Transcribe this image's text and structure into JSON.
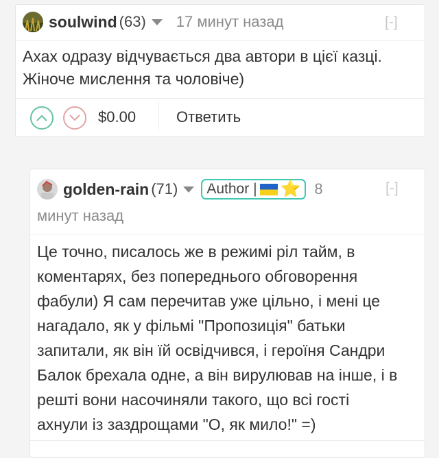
{
  "comments": [
    {
      "username": "soulwind",
      "reputation": "(63)",
      "time": "17 минут назад",
      "collapse_label": "[-]",
      "body": [
        "Ахах одразу відчувається два автори в цієї казці.",
        "Жіноче мислення та чоловіче)"
      ],
      "payout": "$0.00",
      "reply_label": "Ответить"
    },
    {
      "username": "golden-rain",
      "reputation": "(71)",
      "badge": {
        "text": "Author |",
        "flag": "ukraine-flag",
        "star": "⭐"
      },
      "time_part1": "8",
      "time_part2": "минут назад",
      "collapse_label": "[-]",
      "body": [
        "Це точно, писалось же в режимі ріл тайм, в",
        "коментарях, без попереднього обговорення",
        "фабули) Я сам перечитав уже цільно, і мені це",
        "нагадало, як у фільмі \"Пропозиція\" батьки",
        "запитали, як він їй освідчився, і героїня Сандри",
        "Балок брехала одне, а він вирулював на інше, і в",
        "решті вони насочиняли такого, що всі гості",
        "ахнули із заздрощами \"О, як мило!\" =)"
      ]
    }
  ],
  "colors": {
    "upvote": "#63c1a6",
    "downvote": "#e3a3a3",
    "badge_border": "#3fc8b3"
  }
}
